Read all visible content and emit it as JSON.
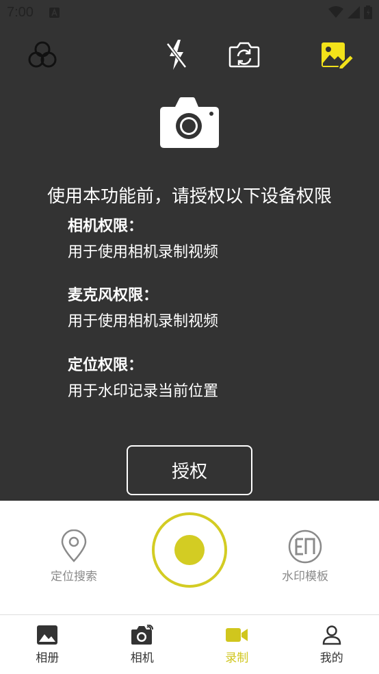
{
  "status_bar": {
    "time": "7:00"
  },
  "toolbar": {
    "filter_icon": "filter-circles-icon",
    "flash_icon": "flash-off-icon",
    "switch_icon": "switch-camera-icon",
    "edit_icon": "edit-image-icon"
  },
  "permission": {
    "title": "使用本功能前，请授权以下设备权限",
    "items": [
      {
        "name": "相机权限：",
        "desc": "用于使用相机录制视频"
      },
      {
        "name": "麦克风权限：",
        "desc": "用于使用相机录制视频"
      },
      {
        "name": "定位权限：",
        "desc": "用于水印记录当前位置"
      }
    ],
    "button_label": "授权"
  },
  "panel": {
    "left_label": "定位搜索",
    "right_label": "水印模板",
    "watermark_icon_text": "EΠ"
  },
  "tabs": [
    {
      "label": "相册",
      "icon": "gallery-icon"
    },
    {
      "label": "相机",
      "icon": "camera-icon"
    },
    {
      "label": "录制",
      "icon": "video-icon",
      "active": true
    },
    {
      "label": "我的",
      "icon": "profile-icon"
    }
  ],
  "colors": {
    "accent": "#d3cc23",
    "dark_bg": "#333333",
    "edit_icon": "#f2e21a"
  }
}
